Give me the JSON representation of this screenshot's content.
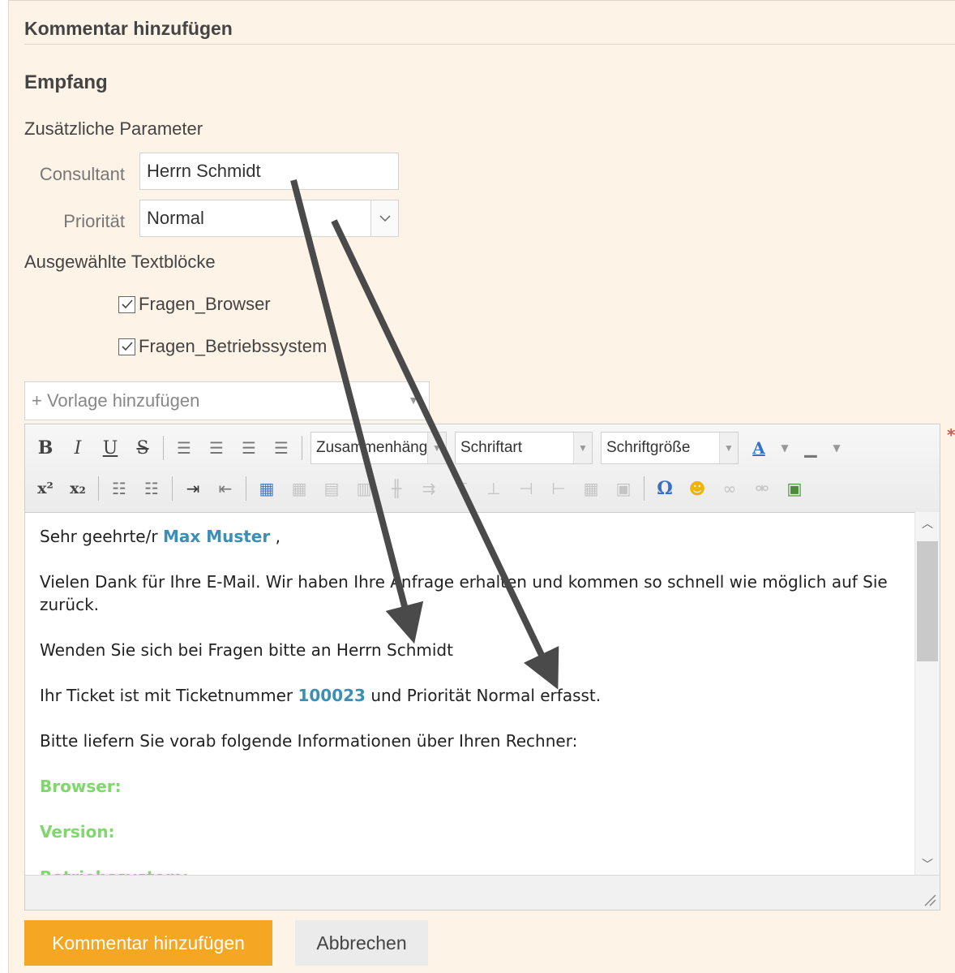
{
  "header": {
    "title": "Kommentar hinzufügen"
  },
  "section": {
    "title": "Empfang"
  },
  "params": {
    "heading": "Zusätzliche Parameter",
    "consultant_label": "Consultant",
    "consultant_value": "Herrn Schmidt",
    "priority_label": "Priorität",
    "priority_value": "Normal"
  },
  "textblocks": {
    "heading": "Ausgewählte Textblöcke",
    "items": [
      {
        "label": "Fragen_Browser",
        "checked": true
      },
      {
        "label": "Fragen_Betriebssystem",
        "checked": true
      }
    ]
  },
  "template": {
    "placeholder": "+ Vorlage hinzufügen"
  },
  "toolbar": {
    "bold": "B",
    "italic": "I",
    "underline": "U",
    "strike": "S",
    "format_combo": "Zusammenhäng",
    "font_combo": "Schriftart",
    "size_combo": "Schriftgröße",
    "superscript": "x²",
    "subscript": "x₂",
    "omega": "Ω"
  },
  "editor": {
    "greeting_prefix": "Sehr geehrte/r ",
    "greeting_name": "Max Muster",
    "greeting_suffix": " ,",
    "p1": "Vielen Dank für Ihre E-Mail. Wir haben Ihre Anfrage erhalten und kommen so schnell wie möglich auf Sie zurück.",
    "p2": "Wenden Sie sich bei Fragen bitte an Herrn Schmidt",
    "p3_prefix": "Ihr Ticket ist mit Ticketnummer ",
    "p3_ticket": "100023",
    "p3_suffix": " und Priorität Normal erfasst.",
    "p4": "Bitte liefern Sie vorab folgende Informationen über Ihren Rechner:",
    "field1": "Browser:",
    "field2": "Version:",
    "field3": "Betriebssystem:"
  },
  "buttons": {
    "submit": "Kommentar hinzufügen",
    "cancel": "Abbrechen"
  },
  "required_marker": "*",
  "colors": {
    "accent": "#f5a623",
    "link_blue": "#3a8fb7",
    "field_green": "#7fd86b",
    "panel_bg": "#fdf3e7"
  }
}
